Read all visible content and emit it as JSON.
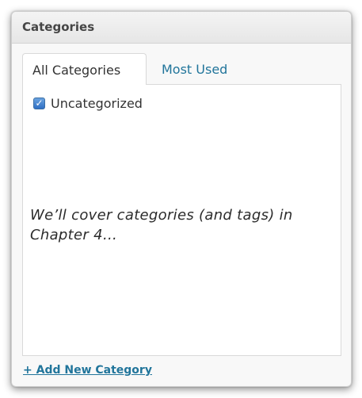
{
  "panel": {
    "title": "Categories"
  },
  "tabs": [
    {
      "label": "All Categories",
      "active": true
    },
    {
      "label": "Most Used",
      "active": false
    }
  ],
  "categories": [
    {
      "label": "Uncategorized",
      "checked": true
    }
  ],
  "annotation": {
    "text": "We’ll cover categories (and tags) in Chapter 4…"
  },
  "add_link": {
    "label": "+ Add New Category"
  },
  "colors": {
    "link": "#21759b",
    "checkbox": "#2f6fc4"
  }
}
